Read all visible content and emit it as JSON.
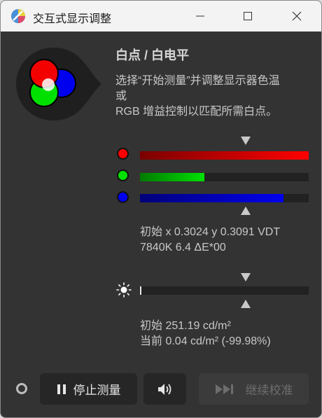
{
  "window": {
    "title": "交互式显示调整"
  },
  "header": {
    "title": "白点 / 白电平",
    "description_lines": [
      "选择“开始测量”并调整显示器色温",
      "或",
      "RGB 增益控制以匹配所需白点。"
    ]
  },
  "rgb_bars": [
    {
      "name": "red",
      "color": "#ff0000",
      "dark": "#7a0000",
      "level": 1.0
    },
    {
      "name": "green",
      "color": "#00e000",
      "dark": "#007a00",
      "level": 0.38
    },
    {
      "name": "blue",
      "color": "#0000ee",
      "dark": "#00007a",
      "level": 0.85
    }
  ],
  "whitepoint_readout": {
    "line1": "初始 x 0.3024 y 0.3091 VDT",
    "line2": "7840K 6.4 ΔE*00"
  },
  "luminance_bar": {
    "icon": "brightness-icon",
    "level": 0.0
  },
  "luminance_readout": {
    "line1": "初始 251.19 cd/m²",
    "line2": "当前 0.04 cd/m² (-99.98%)"
  },
  "buttons": {
    "stop": "停止测量",
    "continue": "继续校准"
  },
  "colors": {
    "window_bg": "#333333",
    "titlebar_bg": "#f3f3f3",
    "text": "#c8c8c8"
  }
}
